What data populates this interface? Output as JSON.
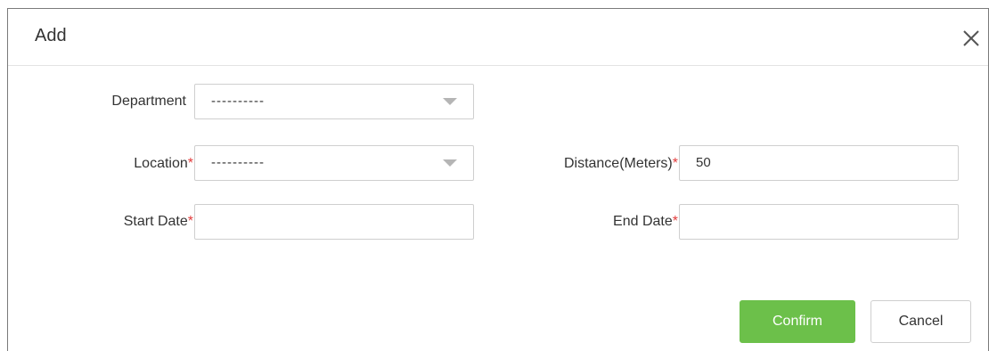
{
  "dialog": {
    "title": "Add",
    "close_icon": "close-icon"
  },
  "form": {
    "department": {
      "label": "Department",
      "value": "----------",
      "icon": "chevron-down-icon"
    },
    "location": {
      "label": "Location",
      "required_marker": "*",
      "value": "----------",
      "icon": "chevron-down-icon"
    },
    "distance": {
      "label": "Distance(Meters)",
      "required_marker": "*",
      "value": "50"
    },
    "start_date": {
      "label": "Start Date",
      "required_marker": "*",
      "value": ""
    },
    "end_date": {
      "label": "End Date",
      "required_marker": "*",
      "value": ""
    }
  },
  "buttons": {
    "confirm_label": "Confirm",
    "cancel_label": "Cancel"
  },
  "colors": {
    "confirm_bg": "#6cc04a",
    "required": "#e23c3c"
  }
}
